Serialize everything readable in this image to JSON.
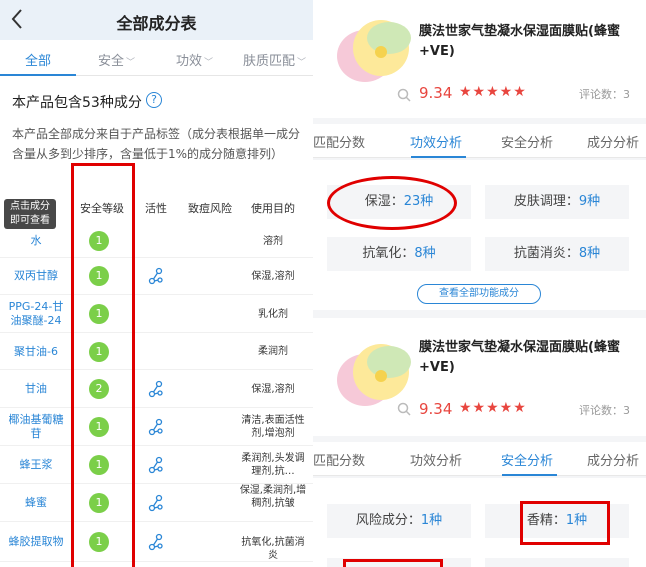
{
  "left": {
    "title": "全部成分表",
    "tabs": [
      {
        "label": "全部",
        "active": true
      },
      {
        "label": "安全",
        "active": false
      },
      {
        "label": "功效",
        "active": false
      },
      {
        "label": "肤质匹配",
        "active": false
      }
    ],
    "count_text": "本产品包含53种成分",
    "description": "本产品全部成分来自于产品标签（成分表根据单一成分含量从多到少排序，含量低于1%的成分随意排列）",
    "columns": [
      "安全等级",
      "活性",
      "致痘风险",
      "使用目的"
    ],
    "tooltip": "点击成分\n即可查看",
    "rows": [
      {
        "name": "水",
        "grade": "1",
        "active": false,
        "usage": "溶剂"
      },
      {
        "name": "双丙甘醇",
        "grade": "1",
        "active": true,
        "usage": "保湿,溶剂"
      },
      {
        "name": "PPG-24-甘油聚醚-24",
        "grade": "1",
        "active": false,
        "usage": "乳化剂"
      },
      {
        "name": "聚甘油-6",
        "grade": "1",
        "active": false,
        "usage": "柔润剂"
      },
      {
        "name": "甘油",
        "grade": "2",
        "active": true,
        "usage": "保湿,溶剂"
      },
      {
        "name": "椰油基葡糖苷",
        "grade": "1",
        "active": true,
        "usage": "清洁,表面活性剂,增泡剂"
      },
      {
        "name": "蜂王浆",
        "grade": "1",
        "active": true,
        "usage": "柔润剂,头发调理剂,抗…"
      },
      {
        "name": "蜂蜜",
        "grade": "1",
        "active": true,
        "usage": "保湿,柔润剂,增稠剂,抗皱"
      },
      {
        "name": "蜂胶提取物",
        "grade": "1",
        "active": true,
        "usage": "抗氧化,抗菌消炎"
      }
    ],
    "colors": {
      "accent": "#2a86d6",
      "grade_green": "#7bcf49",
      "highlight": "#e00000"
    }
  },
  "right": {
    "product_title": "膜法世家气垫凝水保湿面膜贴(蜂蜜+VE)",
    "score": "9.34",
    "stars": "★★★★★",
    "review_label": "评论数：3",
    "subtabs_top": [
      {
        "label": "匹配分数",
        "active": false
      },
      {
        "label": "功效分析",
        "active": true
      },
      {
        "label": "安全分析",
        "active": false
      },
      {
        "label": "成分分析",
        "active": false
      }
    ],
    "efficacy": [
      {
        "label": "保湿：",
        "value": "23种"
      },
      {
        "label": "皮肤调理：",
        "value": "9种"
      },
      {
        "label": "抗氧化：",
        "value": "8种"
      },
      {
        "label": "抗菌消炎：",
        "value": "8种"
      }
    ],
    "view_all": "查看全部功能成分",
    "subtabs_bottom": [
      {
        "label": "匹配分数",
        "active": false
      },
      {
        "label": "功效分析",
        "active": false
      },
      {
        "label": "安全分析",
        "active": true
      },
      {
        "label": "成分分析",
        "active": false
      }
    ],
    "safety": [
      {
        "label": "风险成分：",
        "value": "1种"
      },
      {
        "label": "香精：",
        "value": "1种"
      }
    ]
  }
}
